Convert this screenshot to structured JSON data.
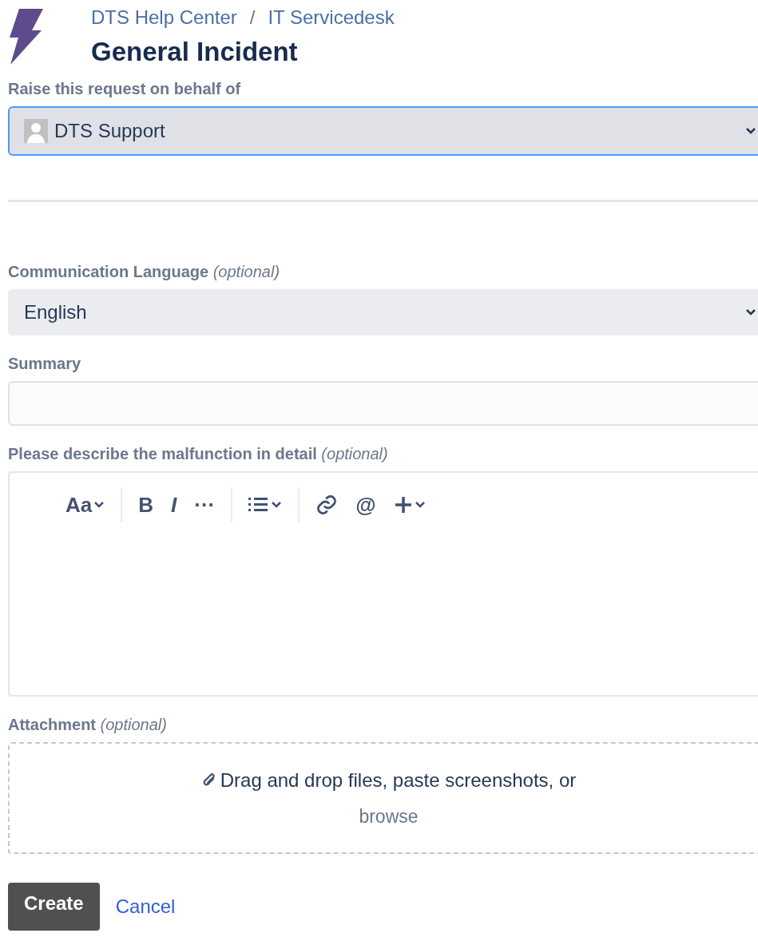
{
  "breadcrumb": {
    "items": [
      "DTS Help Center",
      "IT Servicedesk"
    ],
    "separator": "/"
  },
  "title": "General Incident",
  "requester": {
    "label": "Raise this request on behalf of",
    "value": "DTS Support",
    "focused": true
  },
  "fields": [
    {
      "kind": "select",
      "label": "Communication Language",
      "note": "(optional)",
      "value": "English"
    },
    {
      "kind": "text",
      "label": "Summary"
    },
    {
      "kind": "editor",
      "label": "Please describe the malfunction in detail",
      "note": "(optional)",
      "toolbar": [
        [
          {
            "kind": "text-style",
            "text": "Aa",
            "menu": true
          }
        ],
        [
          {
            "kind": "bold",
            "text": "B"
          },
          {
            "kind": "italic",
            "text": "I"
          },
          {
            "kind": "more",
            "text": "···"
          }
        ],
        [
          {
            "kind": "list",
            "menu": true
          }
        ],
        [
          {
            "kind": "link"
          },
          {
            "kind": "mention",
            "text": "@"
          },
          {
            "kind": "insert",
            "menu": true
          }
        ]
      ]
    },
    {
      "kind": "attachment",
      "label": "Attachment",
      "note": "(optional)",
      "prompt": "Drag and drop files, paste screenshots, or",
      "link": "browse"
    }
  ],
  "actions": {
    "primary": "Create",
    "secondary": "Cancel"
  }
}
